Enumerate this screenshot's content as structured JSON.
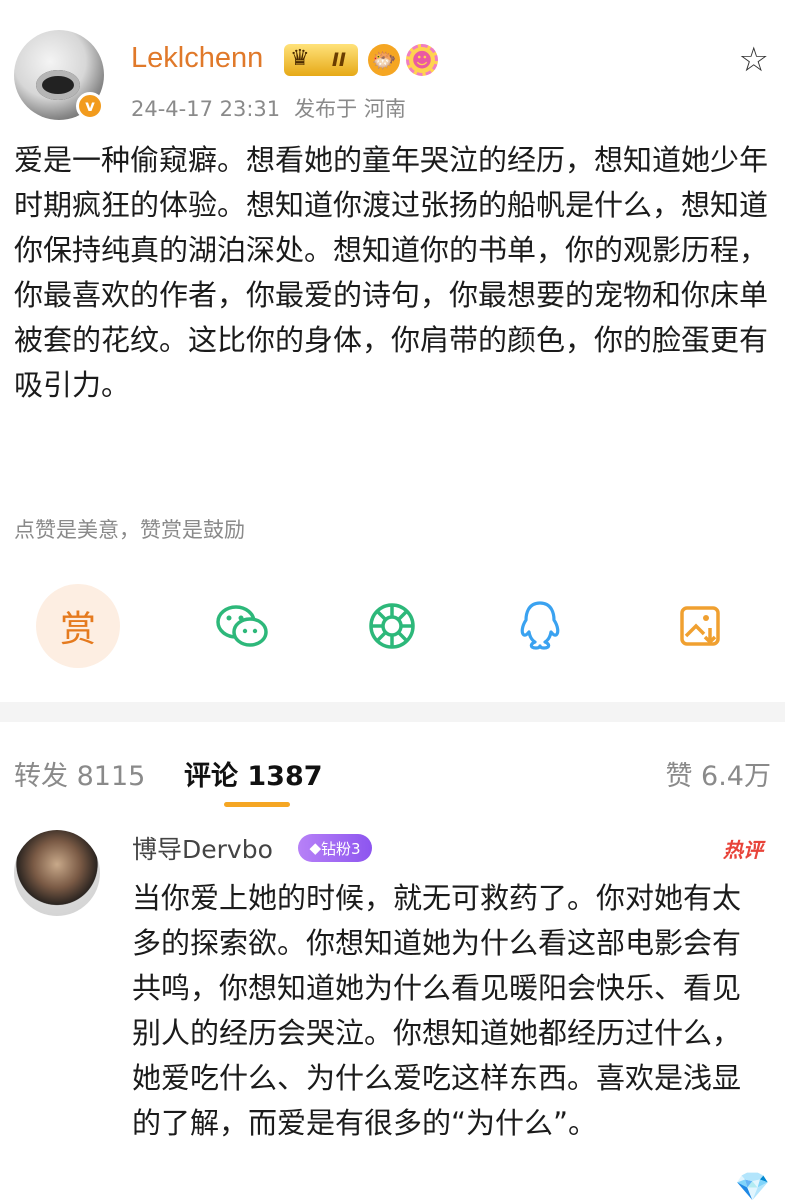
{
  "post": {
    "author": "Leklchenn",
    "badge_level": "II",
    "verified_mark": "v",
    "date": "24-4-17 23:31",
    "location": "发布于 河南",
    "text": "爱是一种偷窥癖。想看她的童年哭泣的经历，想知道她少年时期疯狂的体验。想知道你渡过张扬的船帆是什么，想知道你保持纯真的湖泊深处。想知道你的书单，你的观影历程，你最喜欢的作者，你最爱的诗句，你最想要的宠物和你床单被套的花纹。这比你的身体，你肩带的颜色，你的脸蛋更有吸引力。",
    "slogan": "点赞是美意，赞赏是鼓励"
  },
  "share": {
    "reward_label": "赏",
    "icons": [
      "wechat-icon",
      "moments-icon",
      "qq-icon",
      "save-image-icon"
    ]
  },
  "tabs": {
    "repost": "转发 8115",
    "comment": "评论 1387",
    "like": "赞 6.4万"
  },
  "comment": {
    "author": "博导Dervbo",
    "fan_badge": "钻粉3",
    "hot_tag": "热评",
    "text": "当你爱上她的时候，就无可救药了。你对她有太多的探索欲。你想知道她为什么看这部电影会有共鸣，你想知道她为什么看见暖阳会快乐、看见别人的经历会哭泣。你想知道她都经历过什么，她爱吃什么、为什么爱吃这样东西。喜欢是浅显的了解，而爱是有很多的“为什么”。"
  },
  "colors": {
    "username": "#e0792a",
    "accent": "#f5a623",
    "meta_gray": "#8a8a8a",
    "hot_red": "#e8443a"
  }
}
